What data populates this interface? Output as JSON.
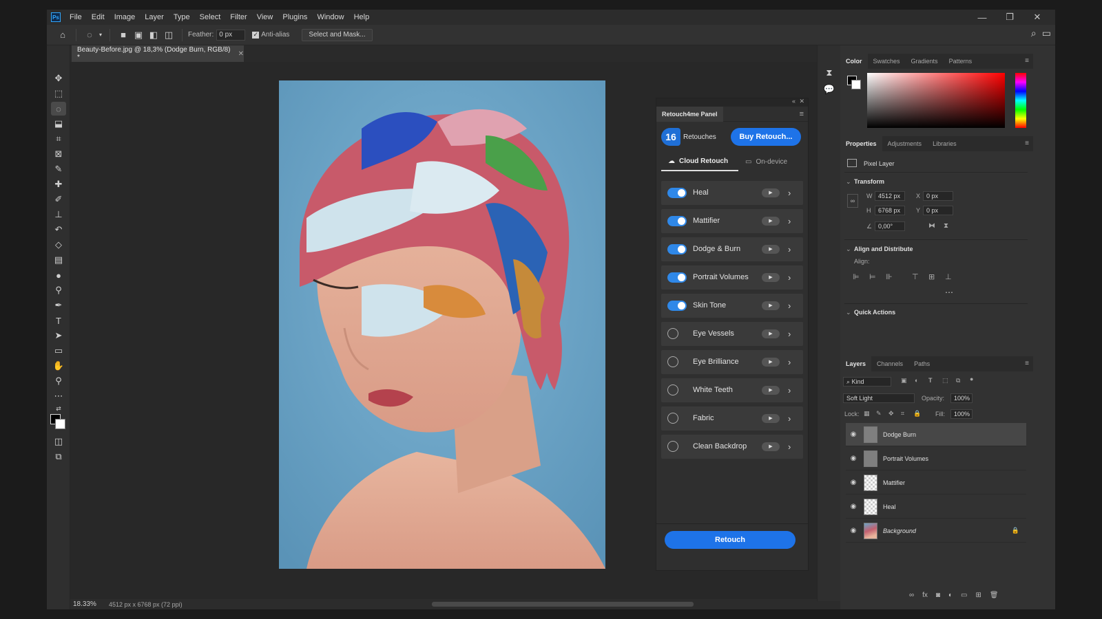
{
  "menubar": {
    "logo": "Ps",
    "items": [
      "File",
      "Edit",
      "Image",
      "Layer",
      "Type",
      "Select",
      "Filter",
      "View",
      "Plugins",
      "Window",
      "Help"
    ]
  },
  "options": {
    "feather_label": "Feather:",
    "feather_value": "0 px",
    "antialias_label": "Anti-alias",
    "select_mask_label": "Select and Mask..."
  },
  "document": {
    "tab_title": "Beauty-Before.jpg @ 18,3% (Dodge Burn, RGB/8) *",
    "zoom": "18.33%",
    "dimensions": "4512 px x 6768 px (72 ppi)"
  },
  "retouch_panel": {
    "title": "Retouch4me Panel",
    "credits_count": "16",
    "credits_label": "Retouches",
    "buy_label": "Buy Retouch...",
    "tabs": [
      {
        "label": "Cloud Retouch",
        "active": true
      },
      {
        "label": "On-device",
        "active": false
      }
    ],
    "items": [
      {
        "label": "Heal",
        "enabled": true
      },
      {
        "label": "Mattifier",
        "enabled": true
      },
      {
        "label": "Dodge & Burn",
        "enabled": true
      },
      {
        "label": "Portrait Volumes",
        "enabled": true
      },
      {
        "label": "Skin Tone",
        "enabled": true
      },
      {
        "label": "Eye Vessels",
        "enabled": false
      },
      {
        "label": "Eye Brilliance",
        "enabled": false
      },
      {
        "label": "White Teeth",
        "enabled": false
      },
      {
        "label": "Fabric",
        "enabled": false
      },
      {
        "label": "Clean Backdrop",
        "enabled": false
      }
    ],
    "retouch_label": "Retouch"
  },
  "color_panel": {
    "tabs": [
      "Color",
      "Swatches",
      "Gradients",
      "Patterns"
    ]
  },
  "properties_panel": {
    "tabs": [
      "Properties",
      "Adjustments",
      "Libraries"
    ],
    "layer_type": "Pixel Layer",
    "transform_title": "Transform",
    "w_label": "W",
    "w_value": "4512 px",
    "h_label": "H",
    "h_value": "6768 px",
    "x_label": "X",
    "x_value": "0 px",
    "y_label": "Y",
    "y_value": "0 px",
    "angle_value": "0,00°",
    "align_title": "Align and Distribute",
    "align_label": "Align:",
    "quick_actions_title": "Quick Actions"
  },
  "layers_panel": {
    "tabs": [
      "Layers",
      "Channels",
      "Paths"
    ],
    "filter_kind": "Kind",
    "blend_mode": "Soft Light",
    "opacity_label": "Opacity:",
    "opacity_value": "100%",
    "lock_label": "Lock:",
    "fill_label": "Fill:",
    "fill_value": "100%",
    "layers": [
      {
        "name": "Dodge Burn",
        "selected": true,
        "thumb": "gray"
      },
      {
        "name": "Portrait Volumes",
        "selected": false,
        "thumb": "gray"
      },
      {
        "name": "Mattifier",
        "selected": false,
        "thumb": "checker"
      },
      {
        "name": "Heal",
        "selected": false,
        "thumb": "checker"
      },
      {
        "name": "Background",
        "selected": false,
        "thumb": "photo",
        "locked": true
      }
    ]
  }
}
